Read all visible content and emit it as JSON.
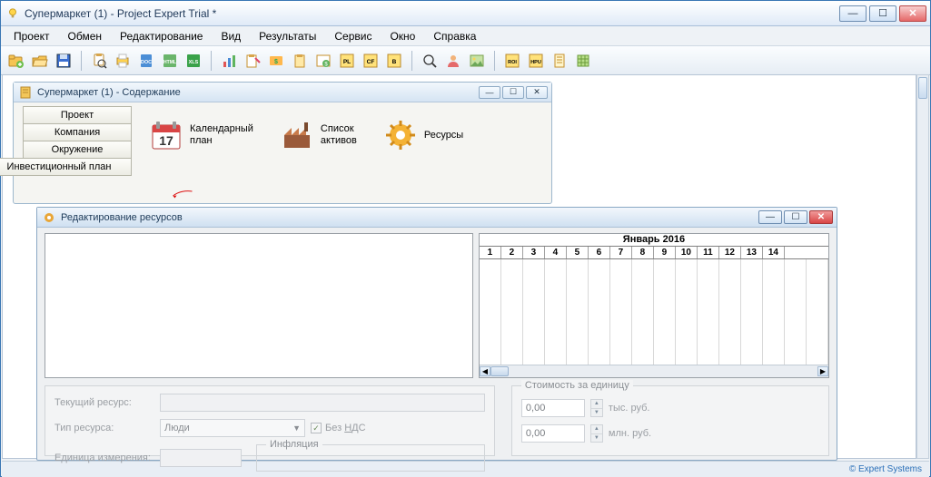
{
  "main": {
    "title": "Супермаркет (1) - Project Expert Trial *",
    "menus": [
      "Проект",
      "Обмен",
      "Редактирование",
      "Вид",
      "Результаты",
      "Сервис",
      "Окно",
      "Справка"
    ]
  },
  "statusbar": {
    "brand": "© Expert Systems"
  },
  "toolbar_icons": [
    "folder-add-icon",
    "folder-open-icon",
    "diskette-icon",
    "sep",
    "magnifier-paste-icon",
    "printer-icon",
    "doc-icon",
    "html-icon",
    "xls-icon",
    "sep",
    "chart-icon",
    "clipboard-pencil-icon",
    "rate-money-icon",
    "clipboard-icon",
    "money-table-icon",
    "pl-icon",
    "cf-icon",
    "bq-icon",
    "sep",
    "zoom-icon",
    "person-icon",
    "picture-icon",
    "sep",
    "roi-icon",
    "hpu-icon",
    "sheet-icon",
    "grid-icon"
  ],
  "child1": {
    "title": "Супермаркет (1) - Содержание",
    "tabs": [
      "Проект",
      "Компания",
      "Окружение",
      "Инвестиционный план"
    ],
    "items": [
      {
        "line1": "Календарный",
        "line2": "план",
        "icon": "calendar-17-icon"
      },
      {
        "line1": "Список",
        "line2": "активов",
        "icon": "factory-icon"
      },
      {
        "line1": "Ресурсы",
        "line2": "",
        "icon": "gear-sparkle-icon"
      }
    ]
  },
  "child2": {
    "title": "Редактирование ресурсов",
    "grid": {
      "month": "Январь 2016",
      "days": [
        "1",
        "2",
        "3",
        "4",
        "5",
        "6",
        "7",
        "8",
        "9",
        "10",
        "11",
        "12",
        "13",
        "14"
      ]
    },
    "form": {
      "current_label": "Текущий ресурс:",
      "type_label": "Тип ресурса:",
      "type_value": "Люди",
      "novatless_label": "Без НДС",
      "uom_label": "Единица измерения:",
      "inflation_legend": "Инфляция",
      "cost_legend": "Стоимость за единицу",
      "value1": "0,00",
      "unit1": "тыс. руб.",
      "value2": "0,00",
      "unit2": "млн. руб."
    }
  }
}
